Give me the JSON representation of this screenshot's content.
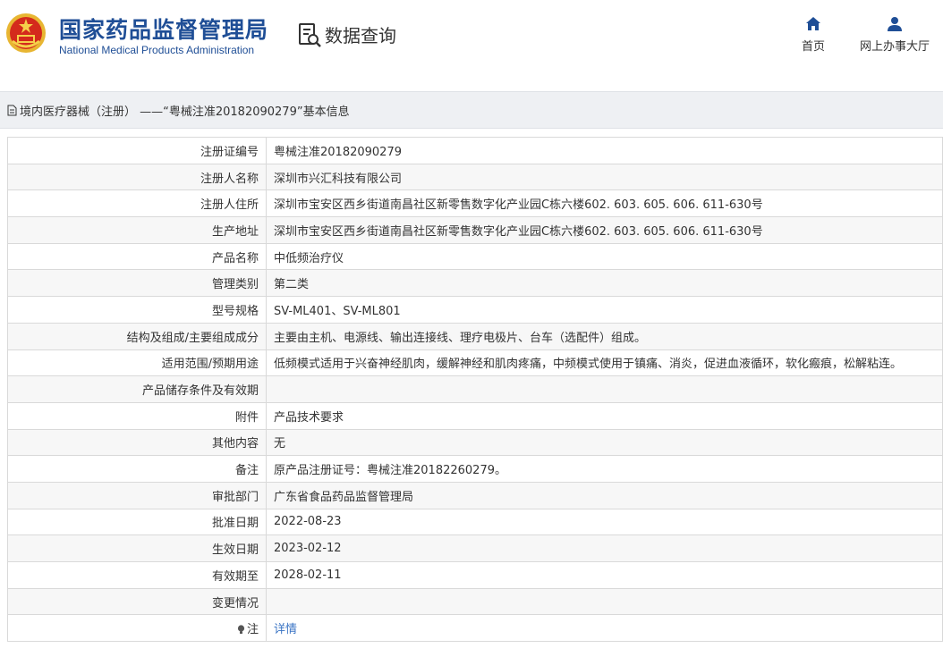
{
  "header": {
    "org_name_cn": "国家药品监督管理局",
    "org_name_en": "National Medical Products Administration",
    "query_title": "数据查询",
    "nav": [
      {
        "label": "首页",
        "icon": "home-icon"
      },
      {
        "label": "网上办事大厅",
        "icon": "user-icon"
      }
    ]
  },
  "breadcrumb": {
    "icon": "document-icon",
    "text": "境内医疗器械（注册） ——“粤械注准20182090279”基本信息"
  },
  "table": {
    "rows": [
      {
        "key": "注册证编号",
        "value": "粤械注准20182090279"
      },
      {
        "key": "注册人名称",
        "value": "深圳市兴汇科技有限公司"
      },
      {
        "key": "注册人住所",
        "value": "深圳市宝安区西乡街道南昌社区新零售数字化产业园C栋六楼602. 603. 605. 606. 611-630号"
      },
      {
        "key": "生产地址",
        "value": "深圳市宝安区西乡街道南昌社区新零售数字化产业园C栋六楼602. 603. 605. 606. 611-630号"
      },
      {
        "key": "产品名称",
        "value": "中低频治疗仪"
      },
      {
        "key": "管理类别",
        "value": "第二类"
      },
      {
        "key": "型号规格",
        "value": "SV-ML401、SV-ML801"
      },
      {
        "key": "结构及组成/主要组成成分",
        "value": "主要由主机、电源线、输出连接线、理疗电极片、台车（选配件）组成。"
      },
      {
        "key": "适用范围/预期用途",
        "value": "低频模式适用于兴奋神经肌肉，缓解神经和肌肉疼痛，中频模式使用于镇痛、消炎，促进血液循环，软化瘢痕，松解粘连。"
      },
      {
        "key": "产品储存条件及有效期",
        "value": ""
      },
      {
        "key": "附件",
        "value": "产品技术要求"
      },
      {
        "key": "其他内容",
        "value": "无"
      },
      {
        "key": "备注",
        "value": "原产品注册证号：粤械注准20182260279。"
      },
      {
        "key": "审批部门",
        "value": "广东省食品药品监督管理局"
      },
      {
        "key": "批准日期",
        "value": "2022-08-23"
      },
      {
        "key": "生效日期",
        "value": "2023-02-12"
      },
      {
        "key": "有效期至",
        "value": "2028-02-11"
      },
      {
        "key": "变更情况",
        "value": ""
      }
    ],
    "note_row": {
      "key": "注",
      "icon": "lightbulb-icon",
      "link": "详情"
    }
  },
  "colors": {
    "brand_blue": "#1f4e96",
    "link_blue": "#3a74c4",
    "breadcrumb_bg": "#eef0f3"
  }
}
